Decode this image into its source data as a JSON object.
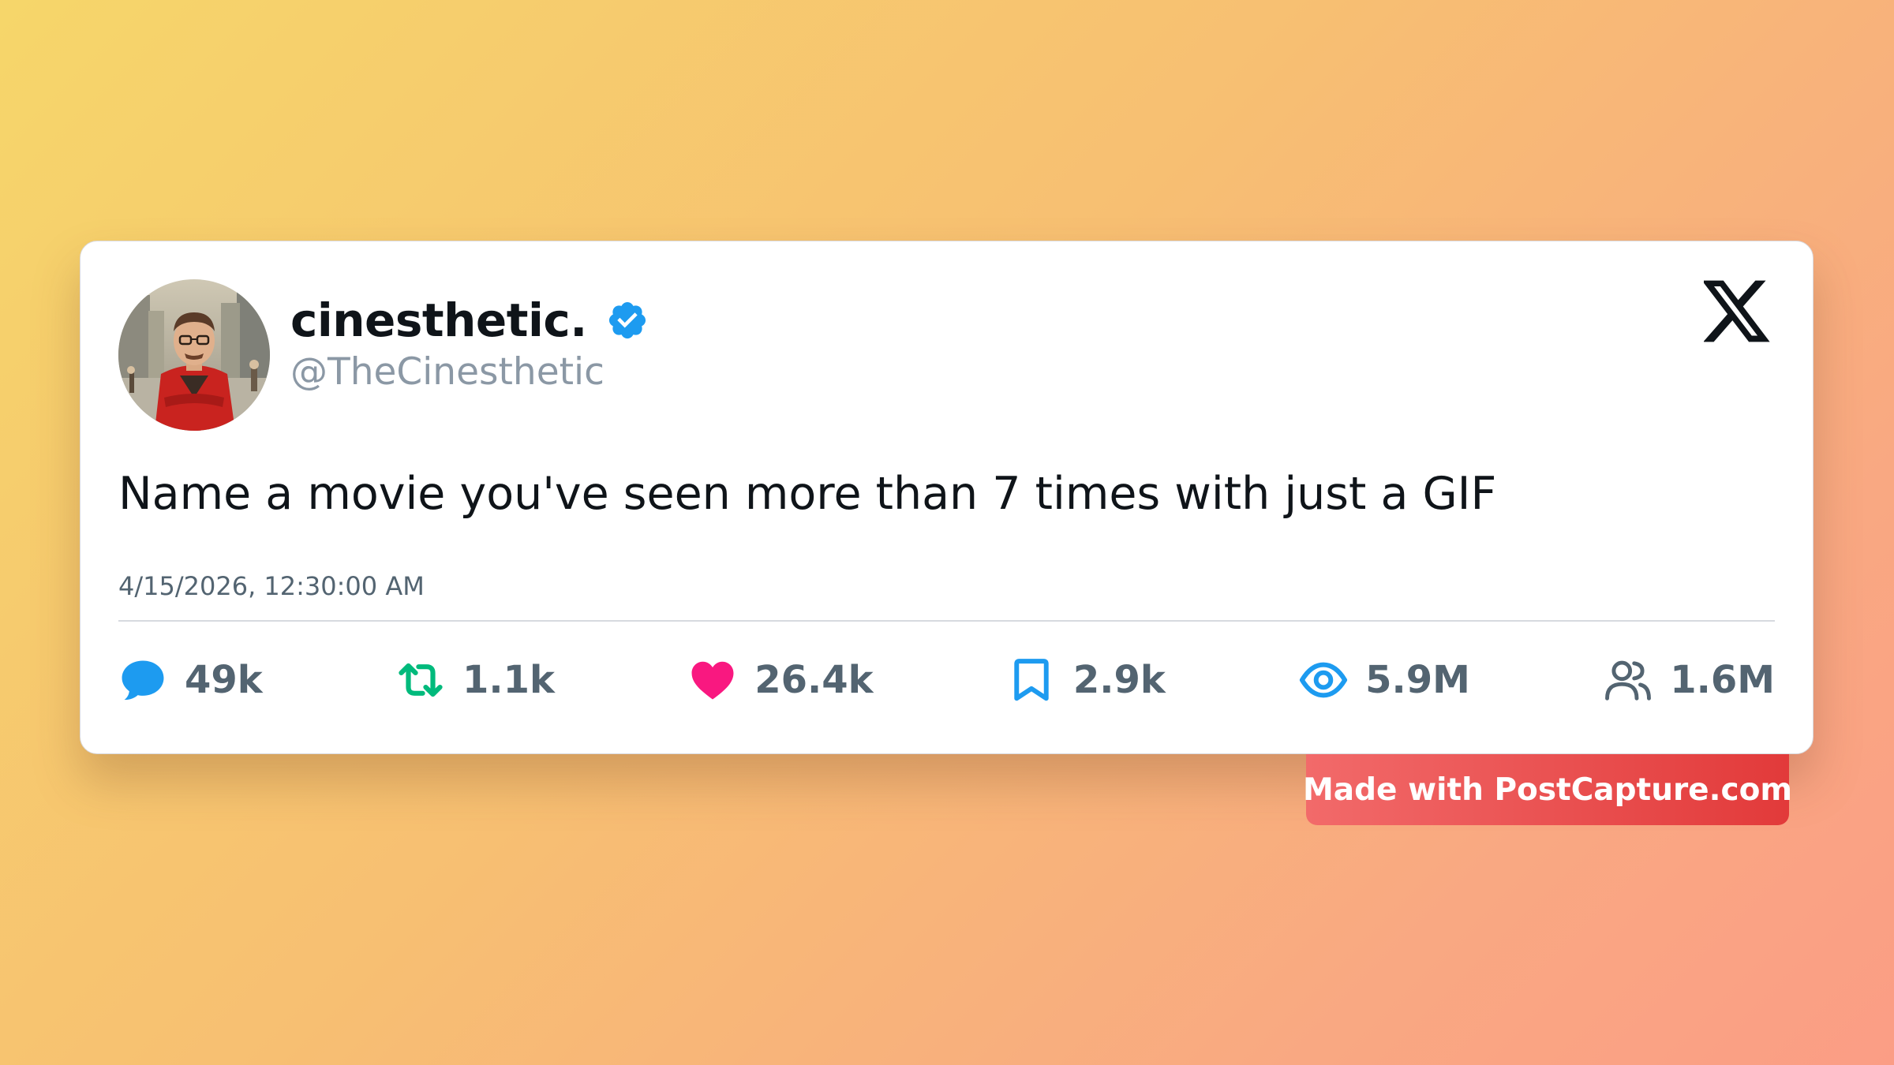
{
  "post": {
    "display_name": "cinesthetic.",
    "handle": "@TheCinesthetic",
    "verified": true,
    "text": "Name a movie you've seen more than 7 times with just a GIF",
    "timestamp": "4/15/2026, 12:30:00 AM",
    "platform_icon": "x-logo-icon",
    "avatar_icon": "avatar-photo"
  },
  "stats": [
    {
      "name": "replies",
      "icon": "comment-icon",
      "value": "49k",
      "color": "#1d9bf0"
    },
    {
      "name": "reposts",
      "icon": "repost-icon",
      "value": "1.1k",
      "color": "#00ba7c"
    },
    {
      "name": "likes",
      "icon": "heart-icon",
      "value": "26.4k",
      "color": "#f91880"
    },
    {
      "name": "bookmarks",
      "icon": "bookmark-icon",
      "value": "2.9k",
      "color": "#1d9bf0"
    },
    {
      "name": "views",
      "icon": "eye-icon",
      "value": "5.9M",
      "color": "#1d9bf0"
    },
    {
      "name": "followers",
      "icon": "users-icon",
      "value": "1.6M",
      "color": "#536471"
    }
  ],
  "branding": {
    "badge_text": "Made with PostCapture.com"
  },
  "colors": {
    "background_start": "#f6d66a",
    "background_end": "#fb9d85",
    "text_primary": "#0f1419",
    "text_secondary": "#536471",
    "verified_blue": "#1d9bf0",
    "badge_red": "#e23a3a"
  }
}
